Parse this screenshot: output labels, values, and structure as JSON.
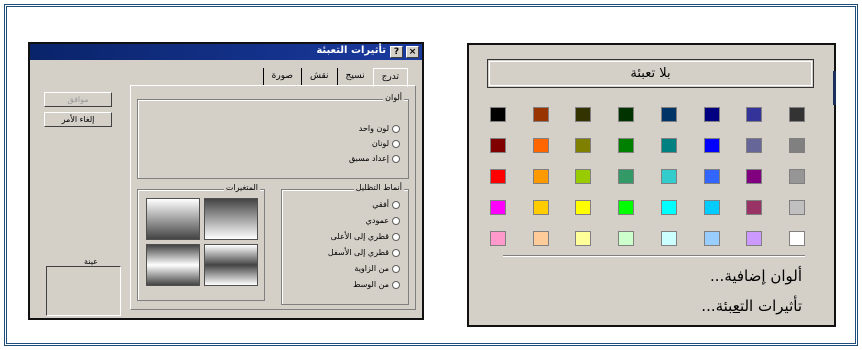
{
  "dialog": {
    "title": "تأثيرات التعبئة",
    "help_glyph": "?",
    "close_glyph": "×",
    "tabs": [
      "نسيج",
      "نقش",
      "صورة",
      "تدرج"
    ],
    "buttons": {
      "ok": "موافق",
      "cancel": "إلغاء الأمر"
    },
    "colors_group": {
      "title": "ألوان",
      "options": [
        "لون واحد",
        "لونان",
        "إعداد مسبق"
      ]
    },
    "shading_group": {
      "title": "أنماط التظليل",
      "options": [
        "أفقي",
        "عمودي",
        "قطري إلى الأعلى",
        "قطري إلى الأسفل",
        "من الزاوية",
        "من الوسط"
      ]
    },
    "variants_group": {
      "title": "المتغيرات"
    },
    "preview_label": "عينة"
  },
  "palette": {
    "no_fill": "بلا تعبئة",
    "colors": [
      [
        "#000000",
        "#993300",
        "#333300",
        "#003300",
        "#003366",
        "#000080",
        "#333399",
        "#333333"
      ],
      [
        "#800000",
        "#FF6600",
        "#808000",
        "#008000",
        "#008080",
        "#0000FF",
        "#666699",
        "#808080"
      ],
      [
        "#FF0000",
        "#FF9900",
        "#99CC00",
        "#339966",
        "#33CCCC",
        "#3366FF",
        "#800080",
        "#969696"
      ],
      [
        "#FF00FF",
        "#FFCC00",
        "#FFFF00",
        "#00FF00",
        "#00FFFF",
        "#00CCFF",
        "#993366",
        "#C0C0C0"
      ],
      [
        "#FF99CC",
        "#FFCC99",
        "#FFFF99",
        "#CCFFCC",
        "#CCFFFF",
        "#99CCFF",
        "#CC99FF",
        "#FFFFFF"
      ]
    ],
    "more_colors": {
      "pre": "ألوان ",
      "hotkey": "إ",
      "post": "ضافية..."
    },
    "fill_effects": {
      "pre": "تأثيرات الت",
      "hotkey": "ع",
      "post": "بئة..."
    }
  }
}
